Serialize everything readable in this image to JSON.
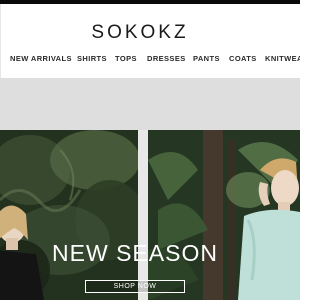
{
  "brand": {
    "logo": "SOKOKZ"
  },
  "nav": {
    "items": [
      {
        "label": "NEW ARRIVALS"
      },
      {
        "label": "SHIRTS"
      },
      {
        "label": "TOPS"
      },
      {
        "label": "DRESSES"
      },
      {
        "label": "PANTS"
      },
      {
        "label": "COATS"
      },
      {
        "label": "KNITWEA"
      }
    ]
  },
  "hero": {
    "title": "NEW SEASON",
    "cta_label": "SHOP NOW"
  }
}
